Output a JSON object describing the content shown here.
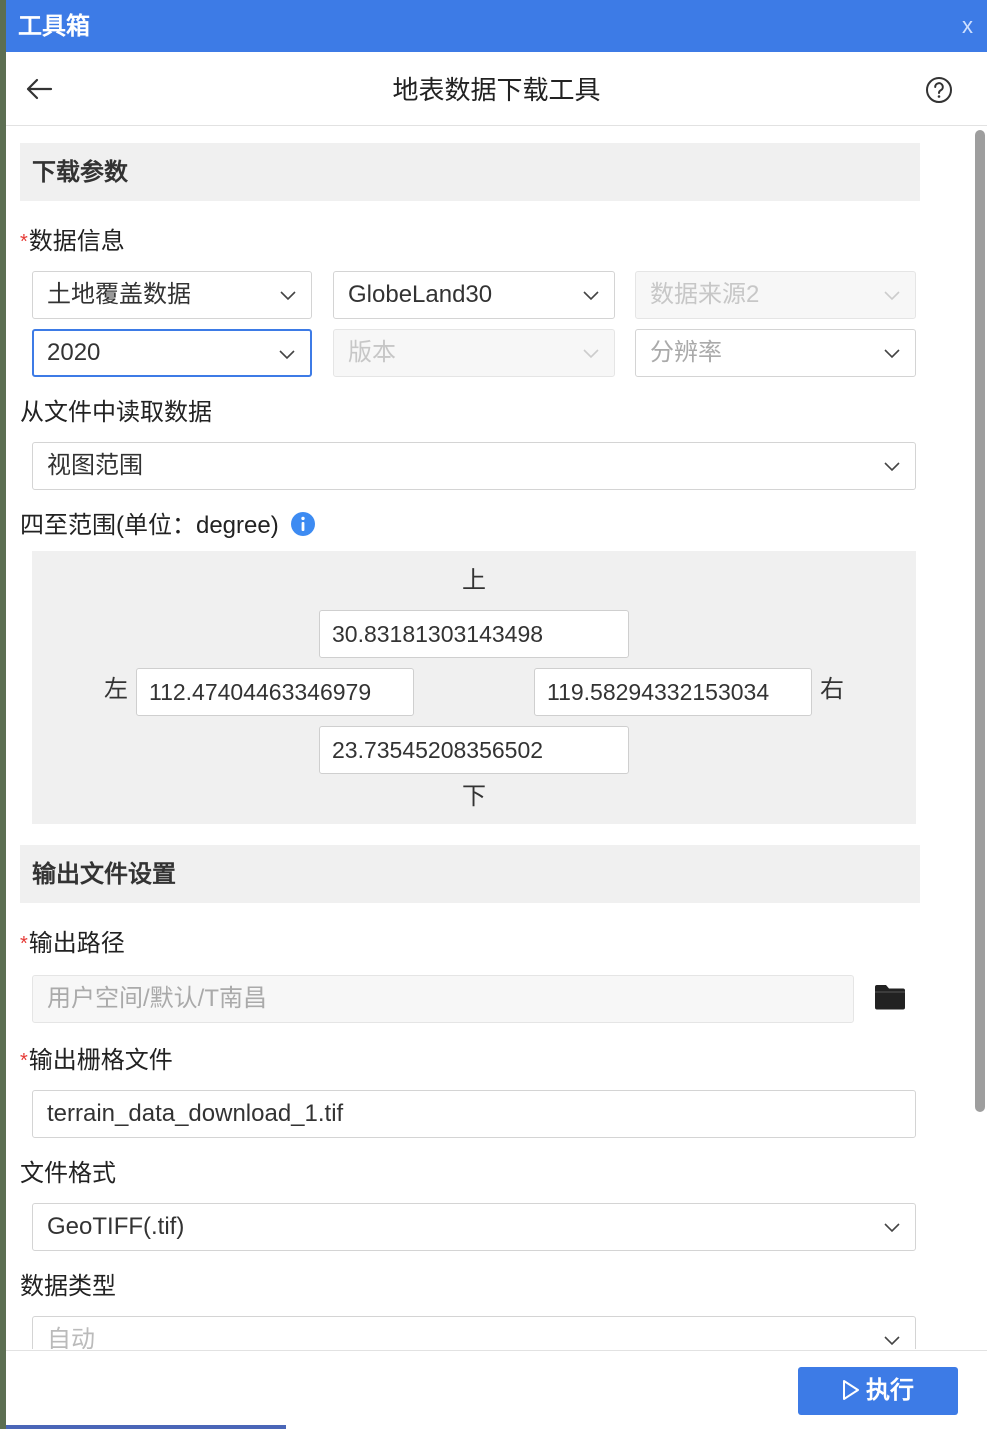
{
  "window": {
    "title": "工具箱",
    "close_label": "x"
  },
  "header": {
    "title": "地表数据下载工具"
  },
  "download_params": {
    "section_title": "下载参数",
    "data_info": {
      "label": "数据信息",
      "data_type": "土地覆盖数据",
      "data_source": "GlobeLand30",
      "data_source2_placeholder": "数据来源2",
      "year": "2020",
      "version_placeholder": "版本",
      "resolution_placeholder": "分辨率"
    },
    "read_from_file": {
      "label": "从文件中读取数据",
      "value": "视图范围"
    },
    "extent": {
      "label": "四至范围(单位：degree)",
      "top_label": "上",
      "top": "30.83181303143498",
      "left_label": "左",
      "left": "112.47404463346979",
      "right_label": "右",
      "right": "119.58294332153034",
      "bottom_label": "下",
      "bottom": "23.73545208356502"
    }
  },
  "output_settings": {
    "section_title": "输出文件设置",
    "output_path": {
      "label": "输出路径",
      "placeholder": "用户空间/默认/T南昌"
    },
    "output_raster": {
      "label": "输出栅格文件",
      "value": "terrain_data_download_1.tif"
    },
    "file_format": {
      "label": "文件格式",
      "value": "GeoTIFF(.tif)"
    },
    "data_type": {
      "label": "数据类型",
      "value": "自动"
    }
  },
  "footer": {
    "run_label": "执行"
  },
  "colors": {
    "accent": "#3d7be6",
    "required": "#e53935",
    "section_bg": "#f0f0f0"
  },
  "icons": [
    "back-arrow-icon",
    "help-icon",
    "info-icon",
    "chevron-down-icon",
    "folder-icon",
    "play-icon"
  ]
}
